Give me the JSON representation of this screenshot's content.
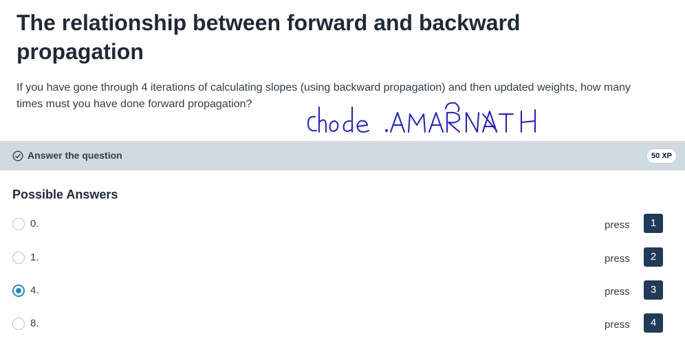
{
  "exercise": {
    "title": "The relationship between forward and backward propagation",
    "question": "If you have gone through 4 iterations of calculating slopes (using backward propagation) and then updated weights, how many times must you have done forward propagation?",
    "handwriting": "chode AMARNATH"
  },
  "header": {
    "label": "Answer the question",
    "xp": "50 XP",
    "icon": "check-circle-icon"
  },
  "answers": {
    "heading": "Possible Answers",
    "options": [
      {
        "label": "0.",
        "press": "press",
        "key": "1",
        "selected": false
      },
      {
        "label": "1.",
        "press": "press",
        "key": "2",
        "selected": false
      },
      {
        "label": "4.",
        "press": "press",
        "key": "3",
        "selected": true
      },
      {
        "label": "8.",
        "press": "press",
        "key": "4",
        "selected": false
      }
    ]
  },
  "colors": {
    "header_bar": "#d0dae1",
    "key_bg": "#203a5a",
    "radio_selected": "#1f8bc8",
    "handwriting": "#1a1ae6"
  }
}
